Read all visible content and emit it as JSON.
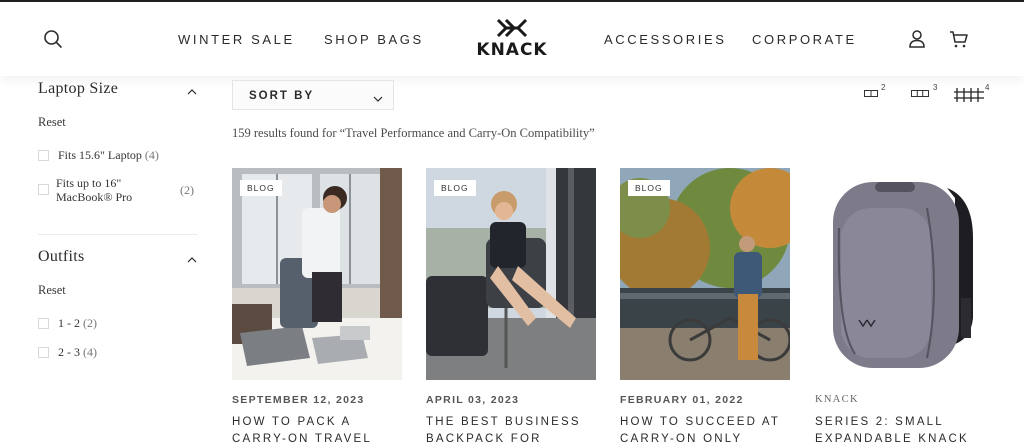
{
  "header": {
    "nav_left": [
      "WINTER SALE",
      "SHOP BAGS"
    ],
    "nav_right": [
      "ACCESSORIES",
      "CORPORATE"
    ],
    "logo_text": "KNACK",
    "icons": [
      "search-icon",
      "account-icon",
      "cart-icon"
    ]
  },
  "sidebar": {
    "filters": [
      {
        "title": "Laptop Size",
        "reset": "Reset",
        "options": [
          {
            "label": "Fits 15.6\" Laptop",
            "count": "(4)"
          },
          {
            "label": "Fits up to 16\"\nMacBook® Pro",
            "count": "(2)"
          }
        ]
      },
      {
        "title": "Outfits",
        "reset": "Reset",
        "options": [
          {
            "label": "1 - 2",
            "count": "(2)"
          },
          {
            "label": "2 - 3",
            "count": "(4)"
          }
        ]
      }
    ]
  },
  "toolbar": {
    "sort_label": "SORT BY",
    "grid_options": [
      "2",
      "3",
      "4"
    ],
    "selected_grid": "4"
  },
  "results_text": "159 results found for “Travel Performance and Carry-On Compatibility”",
  "products": [
    {
      "badge": "BLOG",
      "date": "SEPTEMBER 12, 2023",
      "title": "HOW TO PACK A\nCARRY-ON TRAVEL"
    },
    {
      "badge": "BLOG",
      "date": "APRIL 03, 2023",
      "title": "THE BEST BUSINESS\nBACKPACK FOR"
    },
    {
      "badge": "BLOG",
      "date": "FEBRUARY 01, 2022",
      "title": "HOW TO SUCCEED AT\nCARRY-ON ONLY"
    },
    {
      "vendor": "KNACK",
      "title": "SERIES 2: SMALL\nEXPANDABLE KNACK"
    }
  ],
  "colors": {
    "text": "#2b2b2b",
    "muted": "#777777",
    "backpack": "#7d7b8a"
  }
}
